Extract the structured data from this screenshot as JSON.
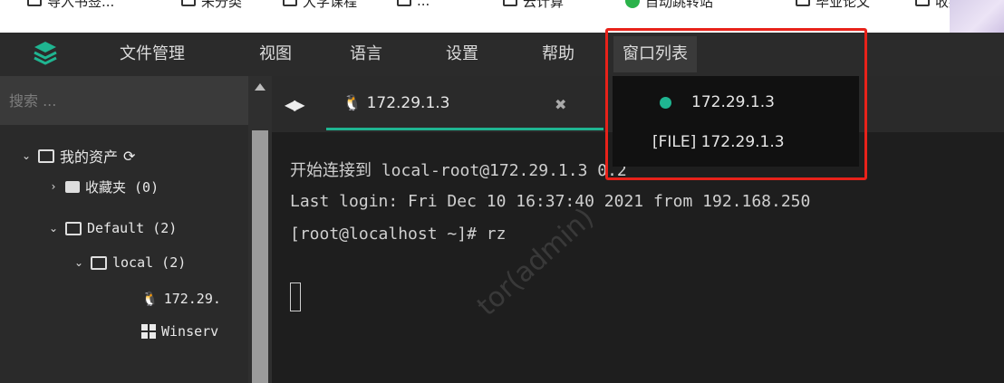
{
  "bookmarks_bar": {
    "items": [
      "导入书签...",
      "未分类",
      "大学课程",
      "...",
      "云计算",
      "自动跳转站",
      "毕业论文",
      "收藏"
    ]
  },
  "menubar": {
    "items": [
      "文件管理",
      "视图",
      "语言",
      "设置",
      "帮助",
      "窗口列表"
    ],
    "active": "窗口列表",
    "accent_color": "#1fb591"
  },
  "sidebar": {
    "search_placeholder": "搜索 ...",
    "tree": {
      "root": "我的资产",
      "favorites": "收藏夹 (0)",
      "default_group": "Default (2)",
      "local_group": "local (2)",
      "host_linux": "172.29.",
      "host_windows": "Winserv"
    }
  },
  "tabs": {
    "active_label": "172.29.1.3",
    "close_glyph": "✖",
    "nav_glyph": "◀▶"
  },
  "window_list": {
    "items": [
      {
        "label": "172.29.1.3",
        "status": "connected"
      },
      {
        "label": "[FILE] 172.29.1.3"
      }
    ]
  },
  "terminal": {
    "lines": [
      "开始连接到 local-root@172.29.1.3 0.2",
      "Last login: Fri Dec 10 16:37:40 2021 from 192.168.250",
      "[root@localhost ~]# rz"
    ],
    "watermark": "tor(admin)"
  }
}
